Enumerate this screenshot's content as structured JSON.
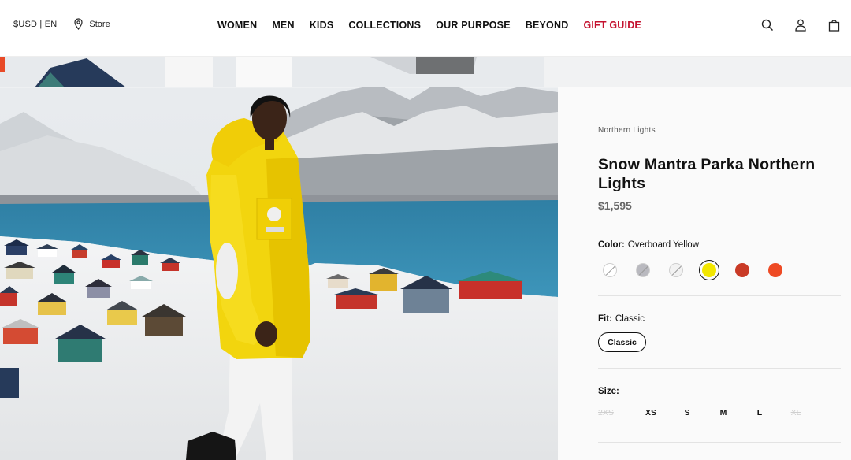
{
  "header": {
    "locale": "$USD | EN",
    "store_label": "Store",
    "nav": [
      {
        "label": "WOMEN"
      },
      {
        "label": "MEN"
      },
      {
        "label": "KIDS"
      },
      {
        "label": "COLLECTIONS"
      },
      {
        "label": "OUR PURPOSE"
      },
      {
        "label": "BEYOND"
      },
      {
        "label": "GIFT GUIDE"
      }
    ],
    "icons": [
      "search-icon",
      "account-icon",
      "bag-icon"
    ],
    "gift_color": "#c4122f"
  },
  "product": {
    "collection": "Northern Lights",
    "title": "Snow Mantra Parka Northern Lights",
    "price": "$1,595",
    "color_label": "Color:",
    "color_value": "Overboard Yellow",
    "swatches": [
      {
        "color": "#ffffff",
        "unavailable": true
      },
      {
        "color": "#b9b9bf",
        "unavailable": true
      },
      {
        "color": "#f2f2f2",
        "unavailable": true
      },
      {
        "color": "#f2e600",
        "selected": true
      },
      {
        "color": "#c93a26"
      },
      {
        "color": "#ee4a24"
      }
    ],
    "fit_label": "Fit:",
    "fit_value": "Classic",
    "fit_button": "Classic",
    "size_label": "Size:",
    "sizes": [
      {
        "label": "2XS",
        "available": false
      },
      {
        "label": "XS",
        "available": true
      },
      {
        "label": "S",
        "available": true
      },
      {
        "label": "M",
        "available": true
      },
      {
        "label": "L",
        "available": true
      },
      {
        "label": "XL",
        "available": false
      }
    ]
  }
}
